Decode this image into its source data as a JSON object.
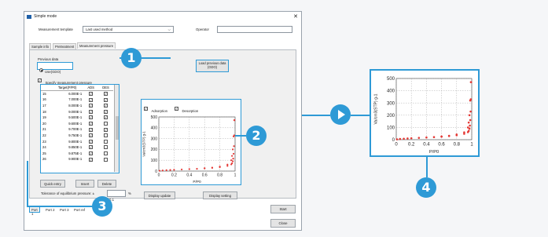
{
  "window": {
    "title": "Simple mode",
    "close_glyph": "✕"
  },
  "header": {
    "template_label": "Measurement template",
    "template_value": "Last used method",
    "operator_label": "Operator",
    "operator_value": ""
  },
  "tabs": [
    {
      "label": "Sample info"
    },
    {
      "label": "Pretreatment"
    },
    {
      "label": "Measurement pressure"
    }
  ],
  "previous": {
    "label": "Previous data",
    "radio_label": "Use(GDO)",
    "load_label": "Load previous data (GDO)"
  },
  "specify_label": "Specify measurement pressure",
  "table": {
    "headers": [
      "",
      "Target(P/P0)",
      "ADS",
      "DES"
    ],
    "rows": [
      {
        "n": "15",
        "target": "6.000E-1",
        "ads": true,
        "des": true
      },
      {
        "n": "16",
        "target": "7.000E-1",
        "ads": true,
        "des": true
      },
      {
        "n": "17",
        "target": "8.000E-1",
        "ads": true,
        "des": true
      },
      {
        "n": "18",
        "target": "9.000E-1",
        "ads": true,
        "des": true
      },
      {
        "n": "19",
        "target": "9.500E-1",
        "ads": true,
        "des": true
      },
      {
        "n": "20",
        "target": "9.600E-1",
        "ads": true,
        "des": false
      },
      {
        "n": "21",
        "target": "9.700E-1",
        "ads": true,
        "des": true
      },
      {
        "n": "22",
        "target": "9.750E-1",
        "ads": true,
        "des": false
      },
      {
        "n": "23",
        "target": "9.800E-1",
        "ads": true,
        "des": false
      },
      {
        "n": "24",
        "target": "9.850E-1",
        "ads": true,
        "des": false
      },
      {
        "n": "25",
        "target": "9.875E-1",
        "ads": true,
        "des": false
      },
      {
        "n": "26",
        "target": "9.900E-1",
        "ads": true,
        "des": false
      }
    ]
  },
  "buttons": {
    "quick_entry": "Quick entry",
    "insert": "Insert",
    "delete": "Delete",
    "display_update": "Display update",
    "display_setting": "Display setting",
    "start": "Start",
    "close": "Close"
  },
  "tolerance": {
    "label": "Tolerance of equilibrium pressure: ±",
    "value": "0.1",
    "unit": "%"
  },
  "legend": {
    "adsorption": "Adsorption",
    "desorption": "Desorption"
  },
  "ports": [
    "Port 1",
    "Port 2",
    "Port 3",
    "Port ref"
  ],
  "badges": [
    "1",
    "2",
    "3",
    "4"
  ],
  "colors": {
    "accent": "#2e9ad6",
    "series": "#e53935"
  },
  "chart_data": {
    "type": "scatter",
    "xlabel": "P/P0",
    "ylabel": "Va/cm3(STP) g-1",
    "xlim": [
      0,
      1
    ],
    "ylim": [
      0,
      500
    ],
    "xticks": [
      "0",
      "0.2",
      "0.4",
      "0.6",
      "0.8",
      "1"
    ],
    "yticks": [
      "0",
      "100",
      "200",
      "300",
      "400",
      "500"
    ],
    "grid": true,
    "series": [
      {
        "x": [
          0.01,
          0.05,
          0.1,
          0.15,
          0.2,
          0.3,
          0.4,
          0.5,
          0.6,
          0.7,
          0.8,
          0.9,
          0.95,
          0.96,
          0.97,
          0.975,
          0.98,
          0.985,
          0.9875,
          0.99
        ],
        "y": [
          3,
          6,
          8,
          10,
          12,
          15,
          18,
          21,
          25,
          30,
          36,
          48,
          62,
          72,
          90,
          115,
          160,
          230,
          330,
          470
        ]
      },
      {
        "x": [
          0.99,
          0.98,
          0.97,
          0.96,
          0.95,
          0.9,
          0.8,
          0.7,
          0.6
        ],
        "y": [
          470,
          320,
          200,
          140,
          100,
          60,
          42,
          32,
          26
        ]
      }
    ]
  }
}
